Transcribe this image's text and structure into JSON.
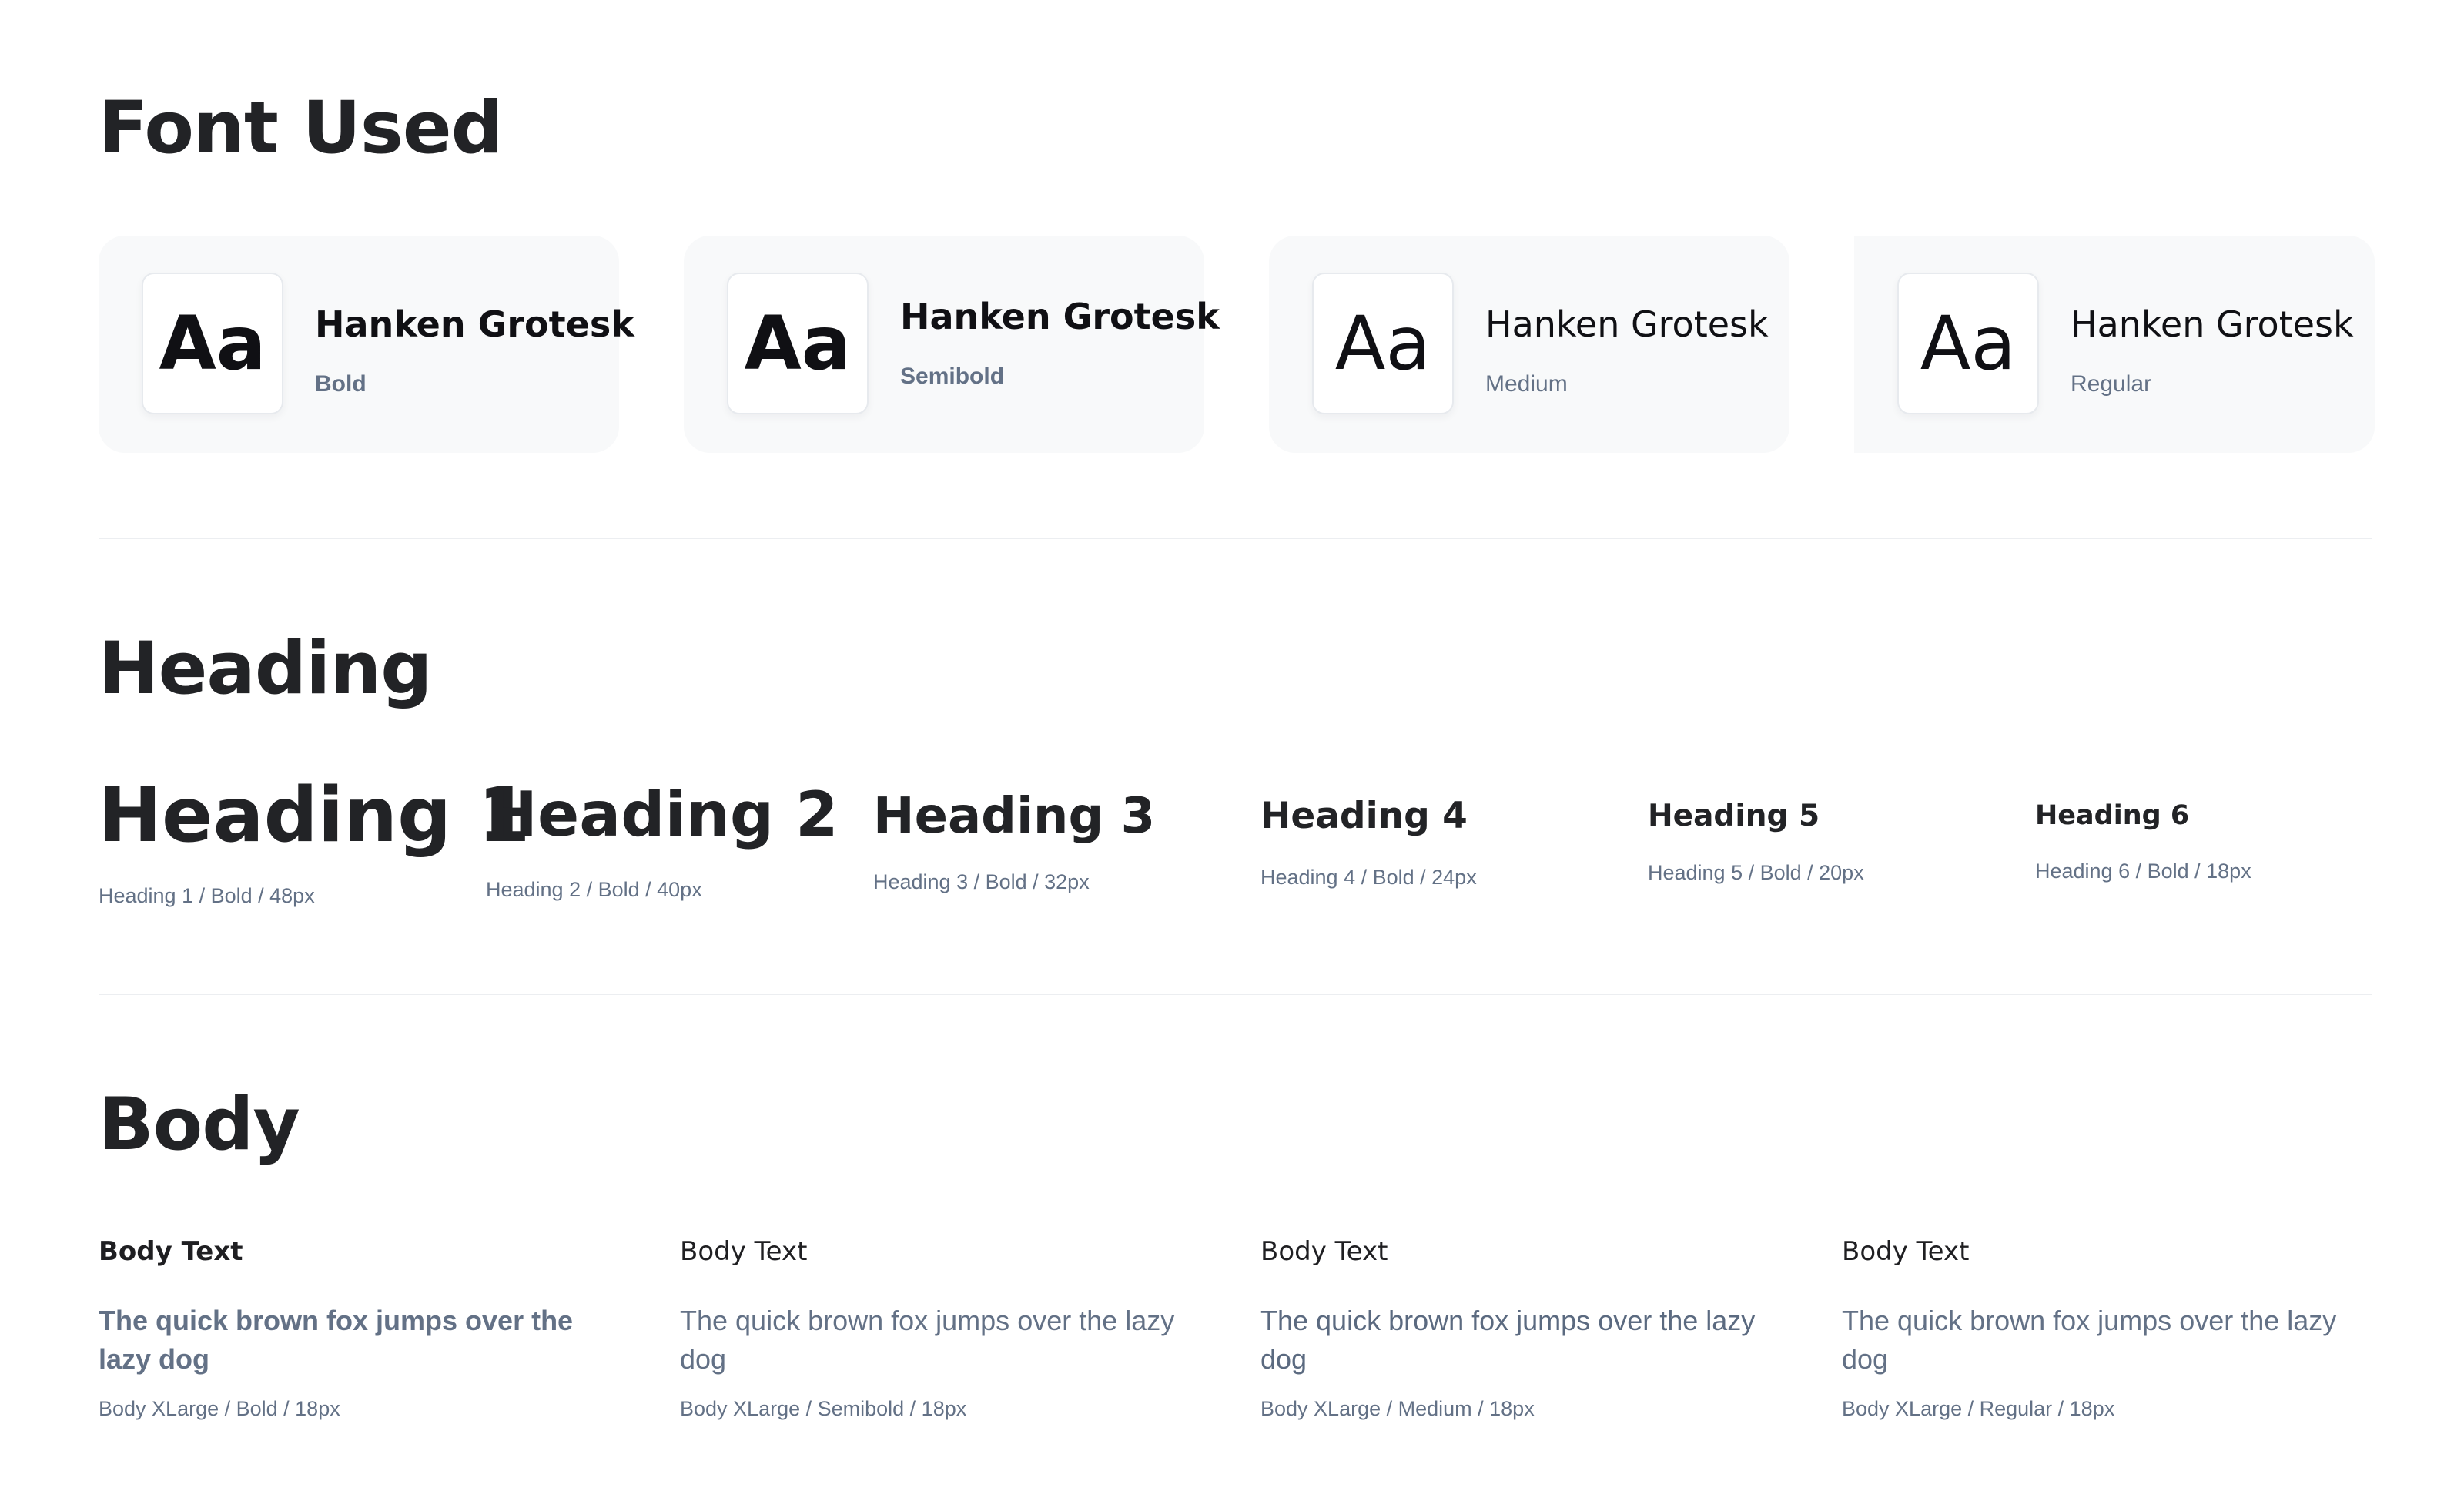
{
  "font_used": {
    "title": "Font Used",
    "cards": [
      {
        "sample": "Aa",
        "name": "Hanken Grotesk",
        "weight": "Bold"
      },
      {
        "sample": "Aa",
        "name": "Hanken Grotesk",
        "weight": "Semibold"
      },
      {
        "sample": "Aa",
        "name": "Hanken Grotesk",
        "weight": "Medium"
      },
      {
        "sample": "Aa",
        "name": "Hanken Grotesk",
        "weight": "Regular"
      }
    ]
  },
  "heading": {
    "title": "Heading",
    "samples": [
      {
        "text": "Heading 1",
        "meta": "Heading 1 / Bold / 48px"
      },
      {
        "text": "Heading 2",
        "meta": "Heading 2 / Bold / 40px"
      },
      {
        "text": "Heading 3",
        "meta": "Heading 3 / Bold / 32px"
      },
      {
        "text": "Heading 4",
        "meta": "Heading 4 / Bold / 24px"
      },
      {
        "text": "Heading 5",
        "meta": "Heading 5 / Bold / 20px"
      },
      {
        "text": "Heading 6",
        "meta": "Heading 6 / Bold / 18px"
      }
    ]
  },
  "body": {
    "title": "Body",
    "samples": [
      {
        "label": "Body Text",
        "text": "The quick brown fox jumps over the lazy dog",
        "meta": "Body XLarge / Bold / 18px"
      },
      {
        "label": "Body Text",
        "text": "The quick brown fox jumps over the lazy dog",
        "meta": "Body XLarge / Semibold / 18px"
      },
      {
        "label": "Body Text",
        "text": "The quick brown fox jumps over the lazy dog",
        "meta": "Body XLarge / Medium / 18px"
      },
      {
        "label": "Body Text",
        "text": "The quick brown fox jumps over the lazy dog",
        "meta": "Body XLarge / Regular / 18px"
      }
    ]
  },
  "colors": {
    "heading_text": "#222326",
    "muted_text": "#637186",
    "card_background": "#f8f9fa",
    "divider": "#eceef1"
  }
}
